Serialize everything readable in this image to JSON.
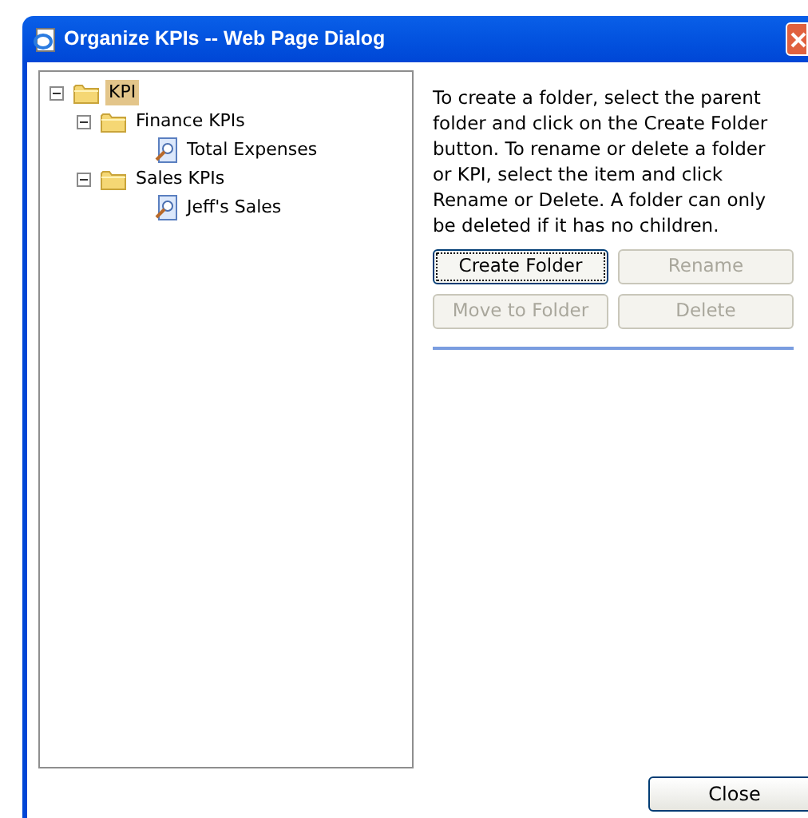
{
  "window": {
    "title": "Organize KPIs -- Web Page Dialog"
  },
  "tree": [
    {
      "label": "KPI",
      "kind": "folder",
      "expanded": true,
      "selected": true,
      "children": [
        {
          "label": "Finance KPIs",
          "kind": "folder",
          "expanded": true,
          "selected": false,
          "children": [
            {
              "label": "Total Expenses",
              "kind": "kpi",
              "selected": false
            }
          ]
        },
        {
          "label": "Sales KPIs",
          "kind": "folder",
          "expanded": true,
          "selected": false,
          "children": [
            {
              "label": "Jeff's Sales",
              "kind": "kpi",
              "selected": false
            }
          ]
        }
      ]
    }
  ],
  "instructions": "To create a folder, select the parent folder and click on the Create Folder button. To rename or delete a folder or KPI, select the item and click Rename or Delete. A folder can only be deleted if it has no children.",
  "actions": [
    {
      "label": "Create Folder",
      "disabled": false
    },
    {
      "label": "Rename",
      "disabled": true
    },
    {
      "label": "Move to Folder",
      "disabled": true
    },
    {
      "label": "Delete",
      "disabled": true
    }
  ],
  "close_button": "Close"
}
